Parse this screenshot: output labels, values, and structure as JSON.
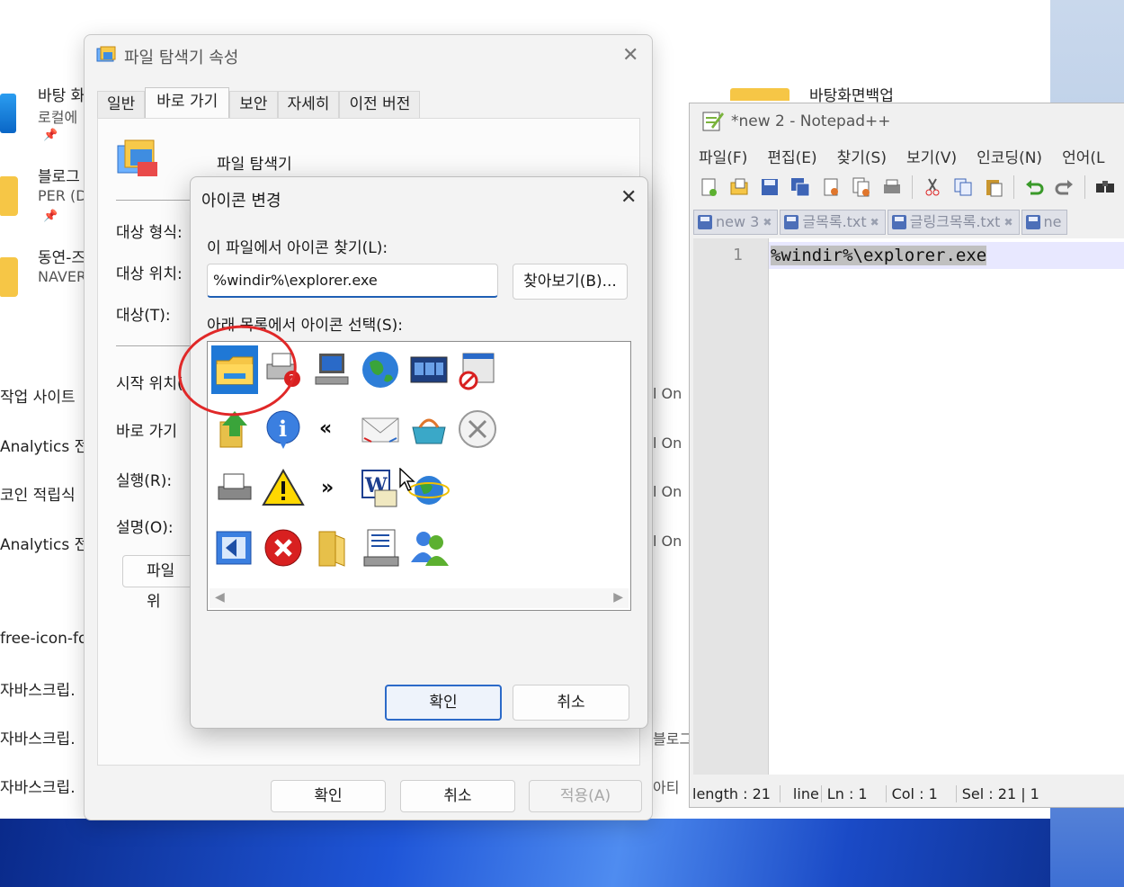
{
  "background": {
    "pinned": [
      {
        "title": "바탕 화",
        "subtitle": "로컬에",
        "icon": "blue-app-icon"
      },
      {
        "title": "블로그",
        "subtitle": "PER (D",
        "icon": "folder-icon"
      },
      {
        "title": "동연-즈",
        "subtitle": "NAVER",
        "icon": "folder-icon"
      }
    ],
    "left_items": [
      "작업 사이트",
      "Analytics 전",
      "코인 적립식",
      "Analytics 전",
      "free-icon-fo",
      "자바스크립.",
      "자바스크립.",
      "자바스크립."
    ],
    "right_items": [
      "l On",
      "l On",
      "l On",
      "l On",
      "블로그",
      "아티"
    ],
    "folder_label": "바탕화면백업"
  },
  "properties": {
    "title": "파일 탐색기 속성",
    "tabs": [
      "일반",
      "바로 가기",
      "보안",
      "자세히",
      "이전 버전"
    ],
    "active_tab": 1,
    "app_name": "파일 탐색기",
    "labels": {
      "target_type": "대상 형식:",
      "target_location": "대상 위치:",
      "target": "대상(T):",
      "start_in": "시작 위치(",
      "shortcut_key": "바로 가기",
      "run": "실행(R):",
      "comment": "설명(O):",
      "open_location": "파일 위"
    },
    "buttons": {
      "ok": "확인",
      "cancel": "취소",
      "apply": "적용(A)"
    }
  },
  "change_icon": {
    "title": "아이콘 변경",
    "file_label": "이 파일에서 아이콘 찾기(L):",
    "file_value": "%windir%\\explorer.exe",
    "browse": "찾아보기(B)...",
    "list_label": "아래 목록에서 아이콘 선택(S):",
    "icons": [
      [
        "folder-icon",
        "printer-help-icon",
        "computer-icon",
        "globe-icon",
        "windows-icon",
        "blocked-window-icon"
      ],
      [
        "folder-up-icon",
        "info-icon",
        "double-left-arrow-icon",
        "mail-icon",
        "shopping-basket-icon",
        "cancel-circle-icon"
      ],
      [
        "fax-printer-icon",
        "warning-icon",
        "double-right-arrow-icon",
        "word-doc-icon",
        "ie-globe-icon"
      ],
      [
        "back-window-icon",
        "error-icon",
        "folder-open-icon",
        "server-icon",
        "users-icon"
      ]
    ],
    "selected_icon": "folder-icon",
    "ok": "확인",
    "cancel": "취소"
  },
  "notepad": {
    "title": "*new 2 - Notepad++",
    "menu": [
      "파일(F)",
      "편집(E)",
      "찾기(S)",
      "보기(V)",
      "인코딩(N)",
      "언어(L"
    ],
    "tabs": [
      "new 3",
      "글목록.txt",
      "글링크목록.txt",
      "ne"
    ],
    "line_number": "1",
    "code": "%windir%\\explorer.exe",
    "status": {
      "length": "length : 21",
      "line": "line",
      "ln": "Ln : 1",
      "col": "Col : 1",
      "sel": "Sel : 21 | 1"
    }
  },
  "colors": {
    "accent": "#1f78d6",
    "highlight_circle": "#e02828",
    "selection": "#c0c0c0"
  }
}
